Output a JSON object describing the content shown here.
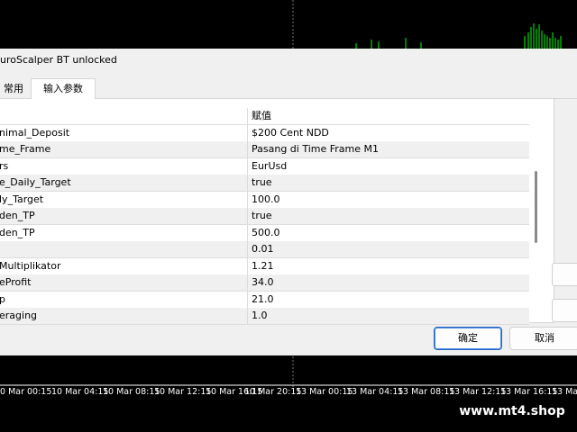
{
  "window": {
    "title": "uroScalper BT unlocked"
  },
  "tabs": [
    {
      "label": "常用"
    },
    {
      "label": "输入参数"
    }
  ],
  "params_table": {
    "header": {
      "variable": "",
      "value": "赋值"
    },
    "rows": [
      {
        "name": "nimal_Deposit",
        "value": "$200 Cent NDD"
      },
      {
        "name": "me_Frame",
        "value": "Pasang di Time Frame M1"
      },
      {
        "name": "rs",
        "value": "EurUsd"
      },
      {
        "name": "e_Daily_Target",
        "value": "true"
      },
      {
        "name": "ly_Target",
        "value": "100.0"
      },
      {
        "name": "den_TP",
        "value": "true"
      },
      {
        "name": "den_TP",
        "value": "500.0"
      },
      {
        "name": "",
        "value": "0.01"
      },
      {
        "name": "Multiplikator",
        "value": "1.21"
      },
      {
        "name": "eProfit",
        "value": "34.0"
      },
      {
        "name": "p",
        "value": "21.0"
      },
      {
        "name": "eraging",
        "value": "1.0"
      }
    ]
  },
  "buttons": {
    "ok": "确定",
    "cancel": "取消"
  },
  "time_axis": [
    {
      "label": "0 Mar 00:15"
    },
    {
      "label": "10 Mar 04:15"
    },
    {
      "label": "10 Mar 08:15"
    },
    {
      "label": "10 Mar 12:15"
    },
    {
      "label": "10 Mar 16:15"
    },
    {
      "label": "10 Mar 20:15"
    },
    {
      "label": "13 Mar 00:15"
    },
    {
      "label": "13 Mar 04:15"
    },
    {
      "label": "13 Mar 08:15"
    },
    {
      "label": "13 Mar 12:15"
    },
    {
      "label": "13 Mar 16:15"
    },
    {
      "label": "13 Mar"
    }
  ],
  "watermark": "www.mt4.shop",
  "colors": {
    "chart_bg": "#000000",
    "candle": "#00ff00",
    "dialog_bg": "#f0f0f0",
    "ok_border": "#2b66c0"
  }
}
